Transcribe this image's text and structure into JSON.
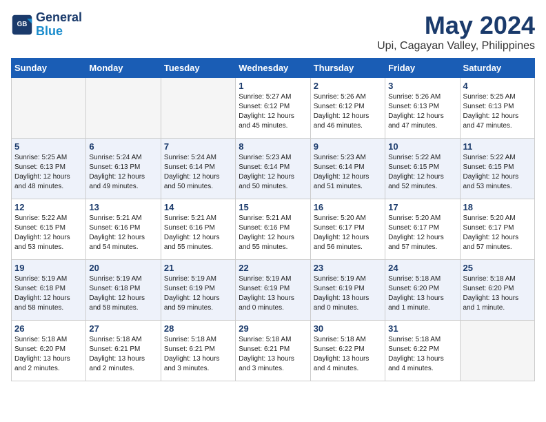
{
  "header": {
    "logo_line1": "General",
    "logo_line2": "Blue",
    "title": "May 2024",
    "subtitle": "Upi, Cagayan Valley, Philippines"
  },
  "weekdays": [
    "Sunday",
    "Monday",
    "Tuesday",
    "Wednesday",
    "Thursday",
    "Friday",
    "Saturday"
  ],
  "weeks": [
    [
      {
        "day": "",
        "info": ""
      },
      {
        "day": "",
        "info": ""
      },
      {
        "day": "",
        "info": ""
      },
      {
        "day": "1",
        "info": "Sunrise: 5:27 AM\nSunset: 6:12 PM\nDaylight: 12 hours\nand 45 minutes."
      },
      {
        "day": "2",
        "info": "Sunrise: 5:26 AM\nSunset: 6:12 PM\nDaylight: 12 hours\nand 46 minutes."
      },
      {
        "day": "3",
        "info": "Sunrise: 5:26 AM\nSunset: 6:13 PM\nDaylight: 12 hours\nand 47 minutes."
      },
      {
        "day": "4",
        "info": "Sunrise: 5:25 AM\nSunset: 6:13 PM\nDaylight: 12 hours\nand 47 minutes."
      }
    ],
    [
      {
        "day": "5",
        "info": "Sunrise: 5:25 AM\nSunset: 6:13 PM\nDaylight: 12 hours\nand 48 minutes."
      },
      {
        "day": "6",
        "info": "Sunrise: 5:24 AM\nSunset: 6:13 PM\nDaylight: 12 hours\nand 49 minutes."
      },
      {
        "day": "7",
        "info": "Sunrise: 5:24 AM\nSunset: 6:14 PM\nDaylight: 12 hours\nand 50 minutes."
      },
      {
        "day": "8",
        "info": "Sunrise: 5:23 AM\nSunset: 6:14 PM\nDaylight: 12 hours\nand 50 minutes."
      },
      {
        "day": "9",
        "info": "Sunrise: 5:23 AM\nSunset: 6:14 PM\nDaylight: 12 hours\nand 51 minutes."
      },
      {
        "day": "10",
        "info": "Sunrise: 5:22 AM\nSunset: 6:15 PM\nDaylight: 12 hours\nand 52 minutes."
      },
      {
        "day": "11",
        "info": "Sunrise: 5:22 AM\nSunset: 6:15 PM\nDaylight: 12 hours\nand 53 minutes."
      }
    ],
    [
      {
        "day": "12",
        "info": "Sunrise: 5:22 AM\nSunset: 6:15 PM\nDaylight: 12 hours\nand 53 minutes."
      },
      {
        "day": "13",
        "info": "Sunrise: 5:21 AM\nSunset: 6:16 PM\nDaylight: 12 hours\nand 54 minutes."
      },
      {
        "day": "14",
        "info": "Sunrise: 5:21 AM\nSunset: 6:16 PM\nDaylight: 12 hours\nand 55 minutes."
      },
      {
        "day": "15",
        "info": "Sunrise: 5:21 AM\nSunset: 6:16 PM\nDaylight: 12 hours\nand 55 minutes."
      },
      {
        "day": "16",
        "info": "Sunrise: 5:20 AM\nSunset: 6:17 PM\nDaylight: 12 hours\nand 56 minutes."
      },
      {
        "day": "17",
        "info": "Sunrise: 5:20 AM\nSunset: 6:17 PM\nDaylight: 12 hours\nand 57 minutes."
      },
      {
        "day": "18",
        "info": "Sunrise: 5:20 AM\nSunset: 6:17 PM\nDaylight: 12 hours\nand 57 minutes."
      }
    ],
    [
      {
        "day": "19",
        "info": "Sunrise: 5:19 AM\nSunset: 6:18 PM\nDaylight: 12 hours\nand 58 minutes."
      },
      {
        "day": "20",
        "info": "Sunrise: 5:19 AM\nSunset: 6:18 PM\nDaylight: 12 hours\nand 58 minutes."
      },
      {
        "day": "21",
        "info": "Sunrise: 5:19 AM\nSunset: 6:19 PM\nDaylight: 12 hours\nand 59 minutes."
      },
      {
        "day": "22",
        "info": "Sunrise: 5:19 AM\nSunset: 6:19 PM\nDaylight: 13 hours\nand 0 minutes."
      },
      {
        "day": "23",
        "info": "Sunrise: 5:19 AM\nSunset: 6:19 PM\nDaylight: 13 hours\nand 0 minutes."
      },
      {
        "day": "24",
        "info": "Sunrise: 5:18 AM\nSunset: 6:20 PM\nDaylight: 13 hours\nand 1 minute."
      },
      {
        "day": "25",
        "info": "Sunrise: 5:18 AM\nSunset: 6:20 PM\nDaylight: 13 hours\nand 1 minute."
      }
    ],
    [
      {
        "day": "26",
        "info": "Sunrise: 5:18 AM\nSunset: 6:20 PM\nDaylight: 13 hours\nand 2 minutes."
      },
      {
        "day": "27",
        "info": "Sunrise: 5:18 AM\nSunset: 6:21 PM\nDaylight: 13 hours\nand 2 minutes."
      },
      {
        "day": "28",
        "info": "Sunrise: 5:18 AM\nSunset: 6:21 PM\nDaylight: 13 hours\nand 3 minutes."
      },
      {
        "day": "29",
        "info": "Sunrise: 5:18 AM\nSunset: 6:21 PM\nDaylight: 13 hours\nand 3 minutes."
      },
      {
        "day": "30",
        "info": "Sunrise: 5:18 AM\nSunset: 6:22 PM\nDaylight: 13 hours\nand 4 minutes."
      },
      {
        "day": "31",
        "info": "Sunrise: 5:18 AM\nSunset: 6:22 PM\nDaylight: 13 hours\nand 4 minutes."
      },
      {
        "day": "",
        "info": ""
      }
    ]
  ]
}
